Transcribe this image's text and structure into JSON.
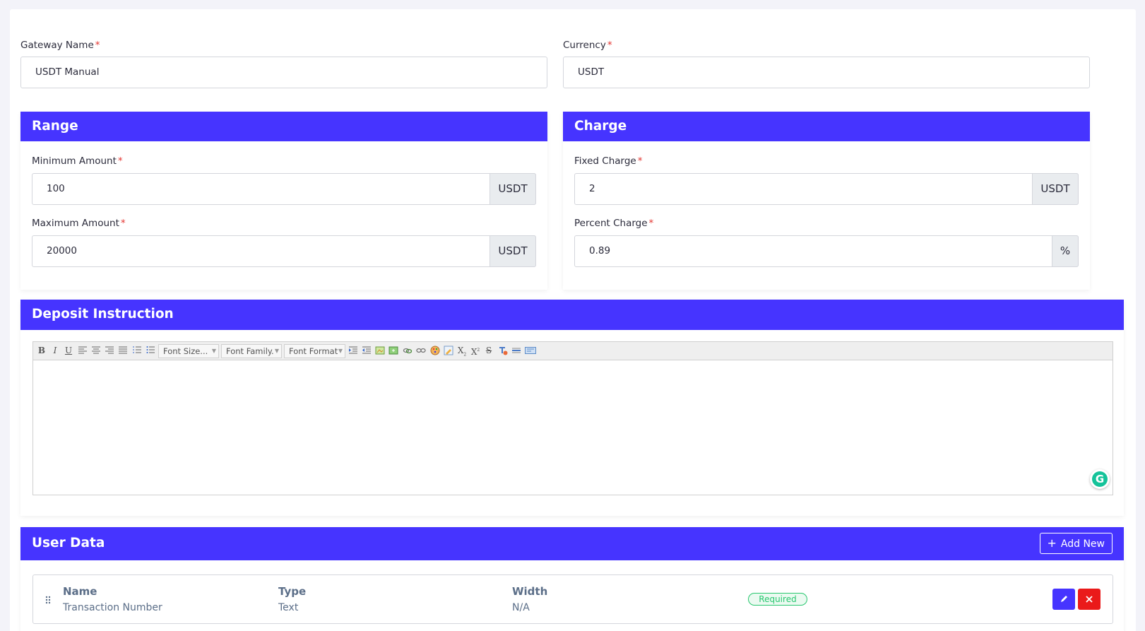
{
  "gateway": {
    "name_label": "Gateway Name",
    "name_value": "USDT Manual",
    "currency_label": "Currency",
    "currency_value": "USDT",
    "required_mark": "*"
  },
  "range": {
    "title": "Range",
    "min_label": "Minimum Amount",
    "min_value": "100",
    "min_addon": "USDT",
    "max_label": "Maximum Amount",
    "max_value": "20000",
    "max_addon": "USDT"
  },
  "charge": {
    "title": "Charge",
    "fixed_label": "Fixed Charge",
    "fixed_value": "2",
    "fixed_addon": "USDT",
    "percent_label": "Percent Charge",
    "percent_value": "0.89",
    "percent_addon": "%"
  },
  "deposit": {
    "title": "Deposit Instruction",
    "toolbar": {
      "bold": "B",
      "italic": "I",
      "underline": "U",
      "font_size": "Font Size...",
      "font_family": "Font Family.",
      "font_format": "Font Format",
      "subscript": "X",
      "superscript": "X",
      "strike": "S"
    },
    "grammarly": "G"
  },
  "user_data": {
    "title": "User Data",
    "add_new": "Add New",
    "columns": {
      "name": "Name",
      "type": "Type",
      "width": "Width"
    },
    "rows": [
      {
        "name": "Transaction Number",
        "type": "Text",
        "width": "N/A",
        "badge": "Required"
      }
    ]
  },
  "colors": {
    "primary": "#4634ff",
    "danger": "#ea1a1a",
    "success": "#28c76f"
  }
}
